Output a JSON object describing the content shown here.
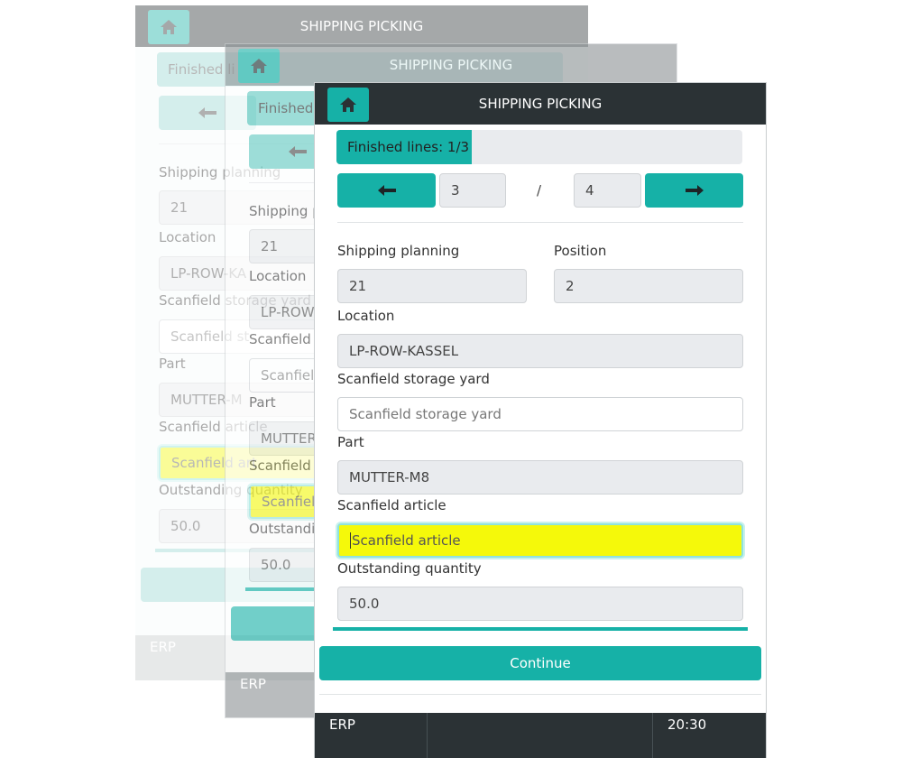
{
  "app": {
    "title": "SHIPPING PICKING",
    "home_icon": "home-icon",
    "accent_color": "#16b1a7",
    "dark_color": "#2b3235",
    "highlight_color": "#f5f90a"
  },
  "progress": {
    "label": "Finished lines: 1/3",
    "finished": 1,
    "total": 3
  },
  "navigation": {
    "prev_icon": "arrow-left-icon",
    "next_icon": "arrow-right-icon",
    "current": "3",
    "separator": "/",
    "total": "4"
  },
  "form": {
    "shipping_planning_label": "Shipping planning",
    "shipping_planning_value": "21",
    "position_label": "Position",
    "position_value": "2",
    "location_label": "Location",
    "location_value": "LP-ROW-KASSEL",
    "storage_yard_label": "Scanfield storage yard",
    "storage_yard_placeholder": "Scanfield storage yard",
    "part_label": "Part",
    "part_value": "MUTTER-M8",
    "article_label": "Scanfield article",
    "article_placeholder": "Scanfield article",
    "outstanding_label": "Outstanding quantity",
    "outstanding_value": "50.0"
  },
  "continue_label": "Continue",
  "footer": {
    "app_name": "ERP",
    "time": "20:30"
  },
  "ghost": {
    "finished_partial": "Finished li",
    "finished_partial_mid": "Finished",
    "shipping_partial": "Shipping p",
    "location_partial": "LP-ROW-KA",
    "location_partial_mid": "LP-ROW",
    "scanfield_s_partial": "Scanfield s",
    "scanfield_st_partial": "Scanfield st",
    "part_partial": "MUTTER-M",
    "part_partial_mid": "MUTTER",
    "scanfield_a_partial": "Scanfield a",
    "scanfield_ar_partial": "Scanfield ar",
    "scanfield_art_partial": "Scanfield art",
    "outstanding_partial": "Outstandin",
    "scanfield_field_partial": "Scanfield"
  }
}
